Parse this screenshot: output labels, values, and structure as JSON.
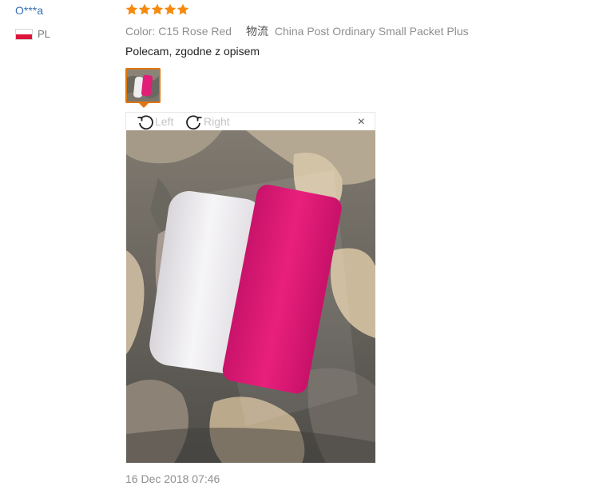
{
  "user": {
    "name": "O***a",
    "country_code": "PL"
  },
  "review": {
    "rating": 5,
    "color_line": "Color: C15 Rose Red",
    "logistics_label": "物流",
    "logistics_value": "China Post Ordinary Small Packet Plus",
    "text": "Polecam, zgodne z opisem",
    "date": "16 Dec 2018 07:46"
  },
  "viewer": {
    "rotate_left_label": "Left",
    "rotate_right_label": "Right",
    "close_label": "×"
  },
  "colors": {
    "star": "#f58a0e",
    "accent": "#e0760e",
    "user_link": "#3a6fb2",
    "muted": "#8f8f8f"
  }
}
